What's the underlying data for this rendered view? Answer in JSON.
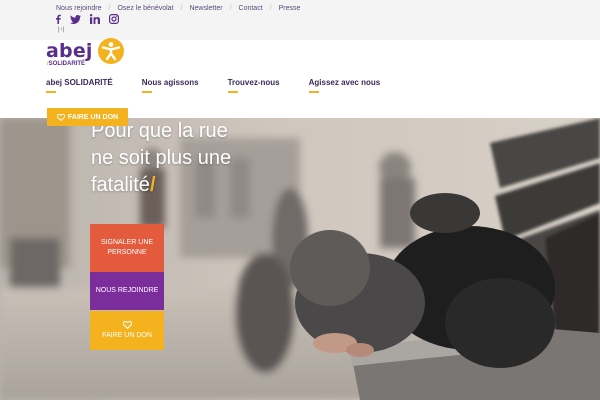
{
  "topbar": {
    "links": [
      "Nous rejoindre",
      "Osez le bénévolat",
      "Newsletter",
      "Contact",
      "Presse"
    ],
    "social": [
      "facebook-icon",
      "twitter-icon",
      "linkedin-icon",
      "instagram-icon"
    ],
    "lang": "|↑|"
  },
  "logo": {
    "word": "abej",
    "sub_slash": "/",
    "sub": "SOLIDARITÉ"
  },
  "nav": {
    "items": [
      "abej SOLIDARITÉ",
      "Nous agissons",
      "Trouvez-nous",
      "Agissez avec nous"
    ]
  },
  "header_cta": {
    "label": "FAIRE UN DON",
    "icon": "heart-icon"
  },
  "hero": {
    "title_line1": "Pour que la rue",
    "title_line2": "ne soit plus une",
    "title_line3": "fatalité",
    "title_slash": "/"
  },
  "actions": {
    "signaler": "SIGNALER UNE PERSONNE",
    "rejoindre": "NOUS REJOINDRE",
    "don": "FAIRE UN DON"
  },
  "colors": {
    "brand_purple": "#5a2d8c",
    "accent_yellow": "#f4b21e",
    "cta_red": "#e35a3c",
    "cta_purple": "#7b2d9c"
  }
}
